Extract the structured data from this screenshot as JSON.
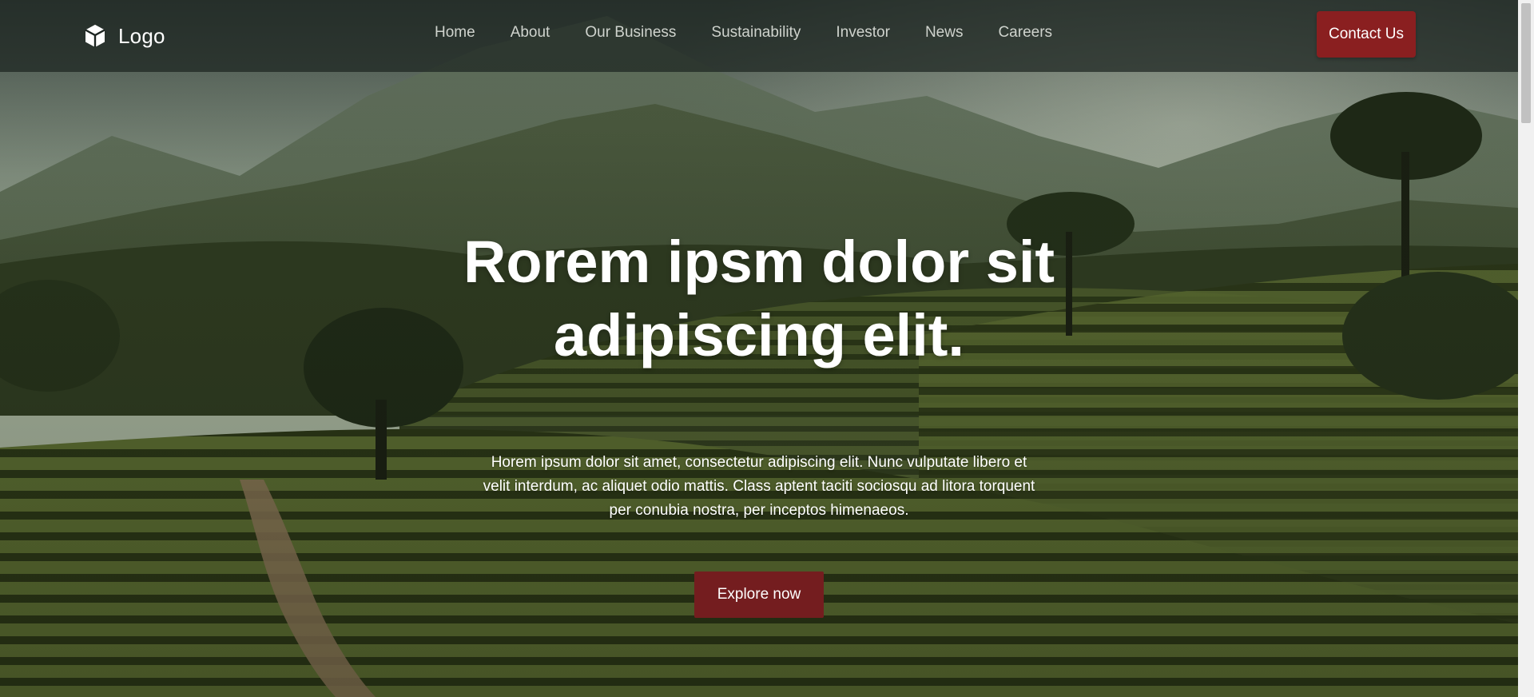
{
  "brand": {
    "logo_text": "Logo",
    "logo_icon": "cube-icon"
  },
  "nav": {
    "items": [
      {
        "label": "Home"
      },
      {
        "label": "About"
      },
      {
        "label": "Our Business"
      },
      {
        "label": "Sustainability"
      },
      {
        "label": "Investor"
      },
      {
        "label": "News"
      },
      {
        "label": "Careers"
      }
    ],
    "contact_label": "Contact Us"
  },
  "hero": {
    "title_line1": "Rorem ipsm dolor sit",
    "title_line2": "adipiscing elit.",
    "description": "Horem ipsum dolor sit amet, consectetur adipiscing elit. Nunc vulputate libero et velit interdum, ac aliquet odio mattis. Class aptent taciti sociosqu ad litora torquent per conubia nostra, per inceptos himenaeos.",
    "cta_label": "Explore now"
  },
  "colors": {
    "primary_button": "#8a1f20",
    "cta_button": "#741d1f",
    "nav_text": "#cfd3cd",
    "navbar_bg": "#1c2420"
  }
}
